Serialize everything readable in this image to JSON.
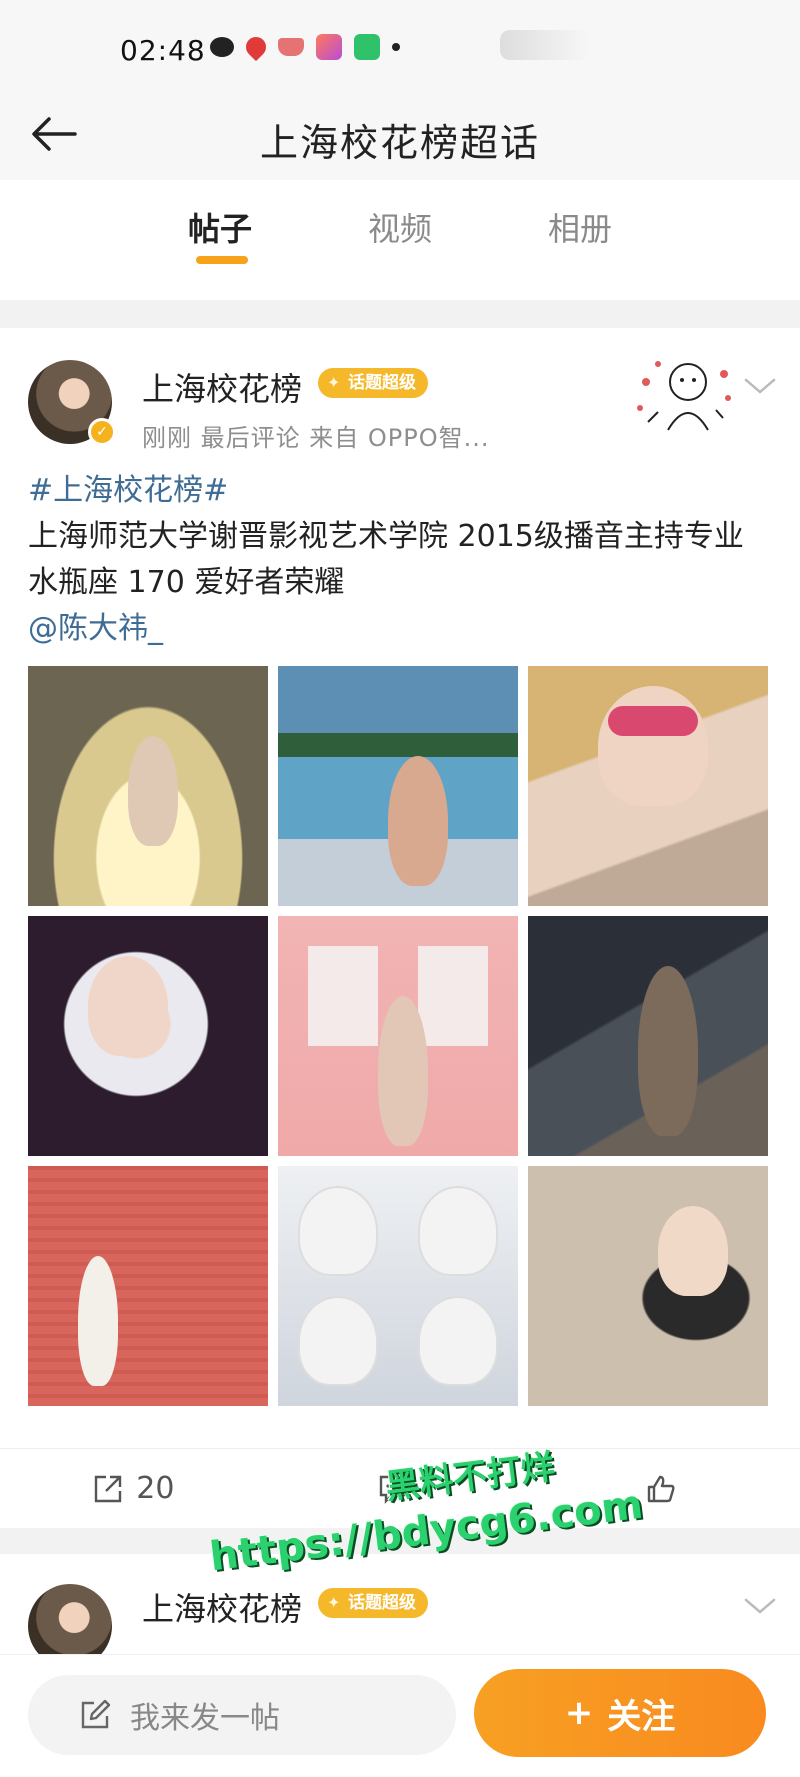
{
  "status_bar": {
    "time": "02:48"
  },
  "header": {
    "title": "上海校花榜超话"
  },
  "tabs": [
    {
      "label": "帖子",
      "active": true
    },
    {
      "label": "视频",
      "active": false
    },
    {
      "label": "相册",
      "active": false
    }
  ],
  "post": {
    "author": "上海校花榜",
    "level_badge": "话题超级",
    "meta": "刚刚 最后评论  来自 OPPO智...",
    "hashtag": "#上海校花榜#",
    "body": "上海师范大学谢晋影视艺术学院 2015级播音主持专业 水瓶座 170 爱好者荣耀",
    "mention": "@陈大祎_",
    "photo_count": 9,
    "actions": {
      "repost_count": "20",
      "comment_count": "",
      "like_count": ""
    }
  },
  "post2": {
    "author": "上海校花榜",
    "level_badge": "话题超级"
  },
  "watermark": {
    "line1": "黑料不打烊",
    "line2": "https://bdycg6.com"
  },
  "bottom_bar": {
    "compose_placeholder": "我来发一帖",
    "follow_label": "关注"
  },
  "colors": {
    "accent": "#f7a21b",
    "link": "#3f6c95",
    "badge": "#f5b82a",
    "watermark": "#2ad16e"
  }
}
